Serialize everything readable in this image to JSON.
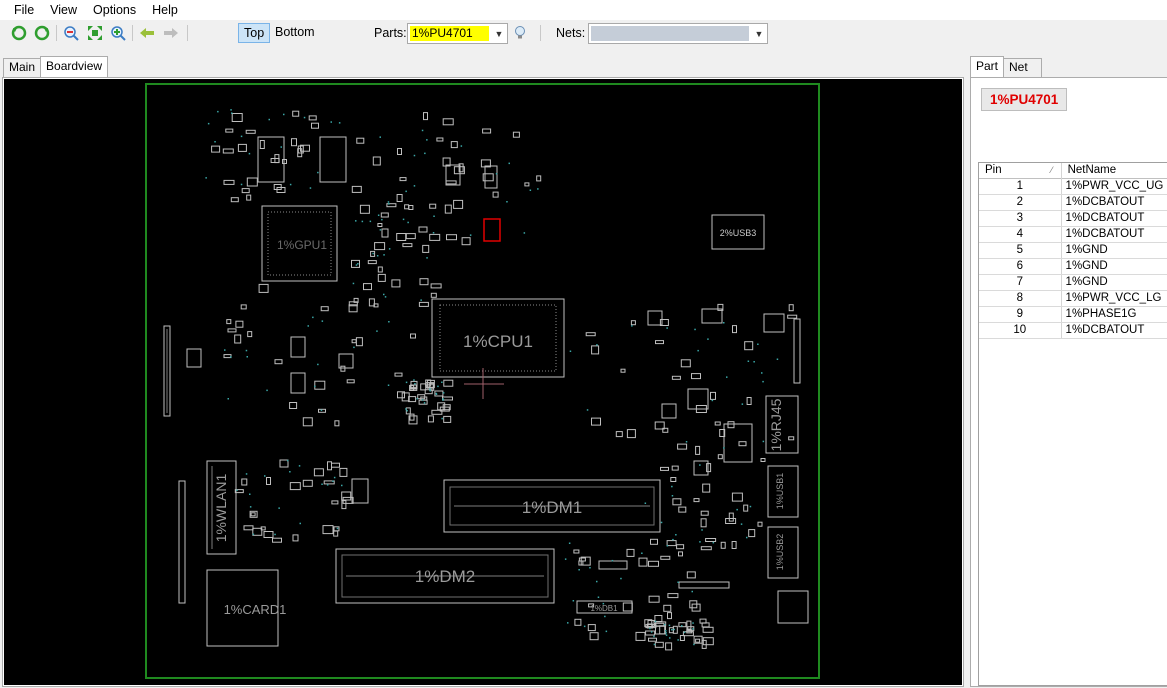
{
  "menu": {
    "items": [
      "File",
      "View",
      "Options",
      "Help"
    ]
  },
  "toolbar": {
    "side_top": "Top",
    "side_bottom": "Bottom",
    "parts_label": "Parts:",
    "parts_value": "1%PU4701",
    "nets_label": "Nets:",
    "nets_value": ""
  },
  "tabs": {
    "main": "Main",
    "boardview": "Boardview"
  },
  "side_tabs": {
    "part": "Part",
    "net": "Net"
  },
  "selected_part": "1%PU4701",
  "pin_table": {
    "headers": {
      "pin": "Pin",
      "net": "NetName"
    },
    "rows": [
      {
        "pin": "1",
        "net": "1%PWR_VCC_UG"
      },
      {
        "pin": "2",
        "net": "1%DCBATOUT"
      },
      {
        "pin": "3",
        "net": "1%DCBATOUT"
      },
      {
        "pin": "4",
        "net": "1%DCBATOUT"
      },
      {
        "pin": "5",
        "net": "1%GND"
      },
      {
        "pin": "6",
        "net": "1%GND"
      },
      {
        "pin": "7",
        "net": "1%GND"
      },
      {
        "pin": "8",
        "net": "1%PWR_VCC_LG"
      },
      {
        "pin": "9",
        "net": "1%PHASE1G"
      },
      {
        "pin": "10",
        "net": "1%DCBATOUT"
      }
    ]
  },
  "board_labels": {
    "usb3": "2%USB3",
    "cpu": "1%CPU1",
    "gpu": "1%GPU1",
    "rj45": "1%RJ45",
    "usb1": "1%USB1",
    "usb2": "1%USB2",
    "wlan": "1%WLAN1",
    "dm1": "1%DM1",
    "dm2": "1%DM2",
    "card": "1%CARD1",
    "db1": "1%DB1"
  },
  "colors": {
    "board_outline": "#1f8a1f",
    "silkscreen": "#bfbfbf",
    "selected_part": "#e00000",
    "parts_highlight": "#ffff00"
  }
}
